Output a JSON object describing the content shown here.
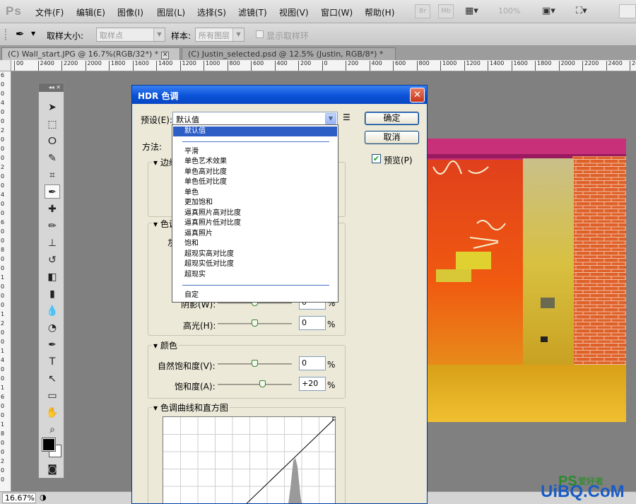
{
  "app": {
    "logo": "Ps"
  },
  "menu": [
    "文件(F)",
    "编辑(E)",
    "图像(I)",
    "图层(L)",
    "选择(S)",
    "滤镜(T)",
    "视图(V)",
    "窗口(W)",
    "帮助(H)"
  ],
  "menubar_buttons": {
    "br": "Br",
    "mb": "Mb",
    "zoom": "100%"
  },
  "options": {
    "sample_size_label": "取样大小:",
    "sample_size_value": "取样点",
    "sample_label": "样本:",
    "sample_value": "所有图层",
    "show_ring_label": "显示取样环"
  },
  "tabs": [
    {
      "label": "(C) Wall_start.JPG @ 16.7%(RGB/32*) *"
    },
    {
      "label": "(C) Justin_selected.psd @ 12.5% (Justin, RGB/8*) *"
    }
  ],
  "ruler_h": [
    "00",
    "2400",
    "2200",
    "2000",
    "1800",
    "1600",
    "1400",
    "1200",
    "1000",
    "800",
    "600",
    "400",
    "200",
    "0",
    "200",
    "400",
    "600",
    "800",
    "1000",
    "1200",
    "1400",
    "1600",
    "1800",
    "2000",
    "2200",
    "2400",
    "26"
  ],
  "ruler_v": [
    "6",
    "0",
    "0",
    "4",
    "0",
    "0",
    "2",
    "0",
    "0",
    "0",
    "2",
    "0",
    "0",
    "4",
    "0",
    "0",
    "6",
    "0",
    "0",
    "8",
    "0",
    "0",
    "1",
    "0",
    "0",
    "0",
    "1",
    "2",
    "0",
    "0",
    "1",
    "4",
    "0",
    "0",
    "1",
    "6",
    "0",
    "0",
    "1",
    "8",
    "0",
    "0",
    "2",
    "0",
    "0"
  ],
  "status": {
    "zoom": "16.67%"
  },
  "watermark": {
    "ps": "PS",
    "name": "爱好者",
    "site": "UiBQ.CoM"
  },
  "dialog": {
    "title": "HDR 色调",
    "close": "✕",
    "preset_label": "预设(E):",
    "preset_value": "默认值",
    "ok": "确定",
    "cancel": "取消",
    "preview_label": "预览(P)",
    "preview_checked": true,
    "method_label": "方法:",
    "edge_group": "边缘",
    "tone_group": "色调",
    "tone_first_label": "灰",
    "shadow_label": "阴影(W):",
    "shadow_value": "0",
    "highlight_label": "高光(H):",
    "highlight_value": "0",
    "color_group": "颜色",
    "vibrance_label": "自然饱和度(V):",
    "vibrance_value": "0",
    "saturation_label": "饱和度(A):",
    "saturation_value": "+20",
    "pct": "%",
    "curve_group": "色调曲线和直方图"
  },
  "preset_dropdown": {
    "items": [
      "默认值",
      "平滑",
      "单色艺术效果",
      "单色高对比度",
      "单色低对比度",
      "单色",
      "更加饱和",
      "逼真照片高对比度",
      "逼真照片低对比度",
      "逼真照片",
      "饱和",
      "超现实高对比度",
      "超现实低对比度",
      "超现实",
      "自定"
    ],
    "selected": "默认值"
  }
}
